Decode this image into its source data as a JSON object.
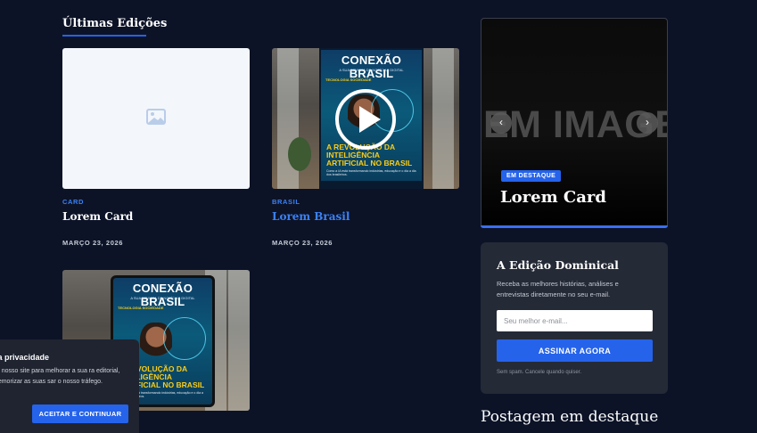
{
  "section": {
    "title": "Últimas Edições"
  },
  "cards": [
    {
      "category": "CARD",
      "title": "Lorem Card",
      "date": "MARÇO 23, 2026"
    },
    {
      "category": "BRASIL",
      "title": "Lorem Brasil",
      "date": "MARÇO 23, 2026"
    }
  ],
  "magazine": {
    "title": "CONEXÃO BRASIL",
    "subtitle": "A SUA REVISTA DE NOTÍCIAS DIGITAL",
    "tag": "TECNOLOGIA SOCIEDADE",
    "headline": "A REVOLUÇÃO DA INTELIGÊNCIA ARTIFICIAL NO BRASIL",
    "description": "Como a IA está transformando indústrias, educação e o dia a dia dos brasileiros."
  },
  "slider": {
    "bg_text": "EM IMAGE",
    "badge": "EM DESTAQUE",
    "title": "Lorem Card",
    "prev_icon": "‹",
    "next_icon": "›"
  },
  "newsletter": {
    "title": "A Edição Dominical",
    "text": "Receba as melhores histórias, análises e entrevistas diretamente no seu e-mail.",
    "placeholder": "Seu melhor e-mail...",
    "button": "ASSINAR AGORA",
    "note": "Sem spam. Cancele quando quiser."
  },
  "featured": {
    "heading": "Postagem em destaque"
  },
  "privacy": {
    "title": "ua privacidade",
    "text": "no nosso site para melhorar a sua ra editorial, memorizar as suas sar o nosso tráfego.",
    "button": "ACEITAR E CONTINUAR"
  },
  "colors": {
    "background": "#0c1327",
    "accent": "#2563eb",
    "link": "#3b82f6"
  }
}
